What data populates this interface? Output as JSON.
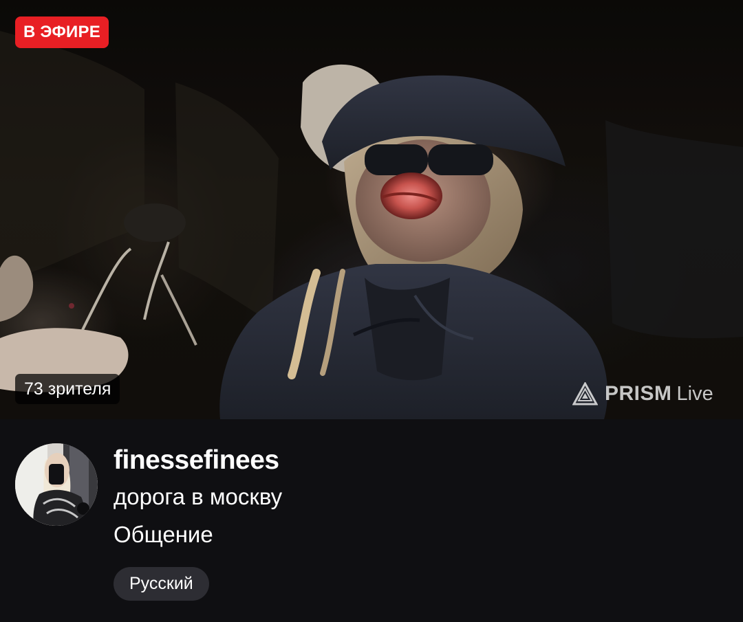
{
  "video": {
    "live_label": "В ЭФИРЕ",
    "viewer_count": "73 зрителя",
    "watermark": {
      "brand": "PRISM",
      "suffix": "Live",
      "icon": "prism-logo-icon"
    }
  },
  "channel": {
    "name": "finessefinees",
    "stream_title": "дорога в москву",
    "category": "Общение",
    "language": "Русский",
    "avatar_icon": "avatar"
  },
  "colors": {
    "live_badge": "#e81f24",
    "background": "#0f0f12",
    "tag_background": "#2d2d33"
  }
}
